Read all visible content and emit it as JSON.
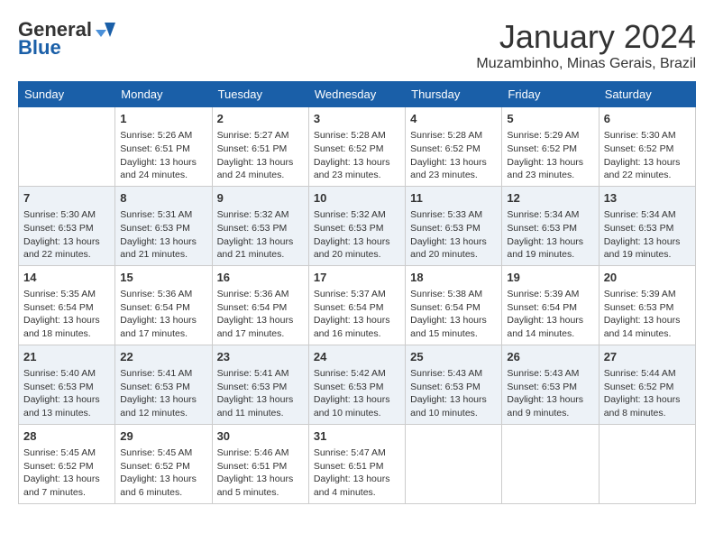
{
  "header": {
    "logo_general": "General",
    "logo_blue": "Blue",
    "month_title": "January 2024",
    "location": "Muzambinho, Minas Gerais, Brazil"
  },
  "weekdays": [
    "Sunday",
    "Monday",
    "Tuesday",
    "Wednesday",
    "Thursday",
    "Friday",
    "Saturday"
  ],
  "weeks": [
    [
      {
        "day": "",
        "info": ""
      },
      {
        "day": "1",
        "info": "Sunrise: 5:26 AM\nSunset: 6:51 PM\nDaylight: 13 hours\nand 24 minutes."
      },
      {
        "day": "2",
        "info": "Sunrise: 5:27 AM\nSunset: 6:51 PM\nDaylight: 13 hours\nand 24 minutes."
      },
      {
        "day": "3",
        "info": "Sunrise: 5:28 AM\nSunset: 6:52 PM\nDaylight: 13 hours\nand 23 minutes."
      },
      {
        "day": "4",
        "info": "Sunrise: 5:28 AM\nSunset: 6:52 PM\nDaylight: 13 hours\nand 23 minutes."
      },
      {
        "day": "5",
        "info": "Sunrise: 5:29 AM\nSunset: 6:52 PM\nDaylight: 13 hours\nand 23 minutes."
      },
      {
        "day": "6",
        "info": "Sunrise: 5:30 AM\nSunset: 6:52 PM\nDaylight: 13 hours\nand 22 minutes."
      }
    ],
    [
      {
        "day": "7",
        "info": "Sunrise: 5:30 AM\nSunset: 6:53 PM\nDaylight: 13 hours\nand 22 minutes."
      },
      {
        "day": "8",
        "info": "Sunrise: 5:31 AM\nSunset: 6:53 PM\nDaylight: 13 hours\nand 21 minutes."
      },
      {
        "day": "9",
        "info": "Sunrise: 5:32 AM\nSunset: 6:53 PM\nDaylight: 13 hours\nand 21 minutes."
      },
      {
        "day": "10",
        "info": "Sunrise: 5:32 AM\nSunset: 6:53 PM\nDaylight: 13 hours\nand 20 minutes."
      },
      {
        "day": "11",
        "info": "Sunrise: 5:33 AM\nSunset: 6:53 PM\nDaylight: 13 hours\nand 20 minutes."
      },
      {
        "day": "12",
        "info": "Sunrise: 5:34 AM\nSunset: 6:53 PM\nDaylight: 13 hours\nand 19 minutes."
      },
      {
        "day": "13",
        "info": "Sunrise: 5:34 AM\nSunset: 6:53 PM\nDaylight: 13 hours\nand 19 minutes."
      }
    ],
    [
      {
        "day": "14",
        "info": "Sunrise: 5:35 AM\nSunset: 6:54 PM\nDaylight: 13 hours\nand 18 minutes."
      },
      {
        "day": "15",
        "info": "Sunrise: 5:36 AM\nSunset: 6:54 PM\nDaylight: 13 hours\nand 17 minutes."
      },
      {
        "day": "16",
        "info": "Sunrise: 5:36 AM\nSunset: 6:54 PM\nDaylight: 13 hours\nand 17 minutes."
      },
      {
        "day": "17",
        "info": "Sunrise: 5:37 AM\nSunset: 6:54 PM\nDaylight: 13 hours\nand 16 minutes."
      },
      {
        "day": "18",
        "info": "Sunrise: 5:38 AM\nSunset: 6:54 PM\nDaylight: 13 hours\nand 15 minutes."
      },
      {
        "day": "19",
        "info": "Sunrise: 5:39 AM\nSunset: 6:54 PM\nDaylight: 13 hours\nand 14 minutes."
      },
      {
        "day": "20",
        "info": "Sunrise: 5:39 AM\nSunset: 6:53 PM\nDaylight: 13 hours\nand 14 minutes."
      }
    ],
    [
      {
        "day": "21",
        "info": "Sunrise: 5:40 AM\nSunset: 6:53 PM\nDaylight: 13 hours\nand 13 minutes."
      },
      {
        "day": "22",
        "info": "Sunrise: 5:41 AM\nSunset: 6:53 PM\nDaylight: 13 hours\nand 12 minutes."
      },
      {
        "day": "23",
        "info": "Sunrise: 5:41 AM\nSunset: 6:53 PM\nDaylight: 13 hours\nand 11 minutes."
      },
      {
        "day": "24",
        "info": "Sunrise: 5:42 AM\nSunset: 6:53 PM\nDaylight: 13 hours\nand 10 minutes."
      },
      {
        "day": "25",
        "info": "Sunrise: 5:43 AM\nSunset: 6:53 PM\nDaylight: 13 hours\nand 10 minutes."
      },
      {
        "day": "26",
        "info": "Sunrise: 5:43 AM\nSunset: 6:53 PM\nDaylight: 13 hours\nand 9 minutes."
      },
      {
        "day": "27",
        "info": "Sunrise: 5:44 AM\nSunset: 6:52 PM\nDaylight: 13 hours\nand 8 minutes."
      }
    ],
    [
      {
        "day": "28",
        "info": "Sunrise: 5:45 AM\nSunset: 6:52 PM\nDaylight: 13 hours\nand 7 minutes."
      },
      {
        "day": "29",
        "info": "Sunrise: 5:45 AM\nSunset: 6:52 PM\nDaylight: 13 hours\nand 6 minutes."
      },
      {
        "day": "30",
        "info": "Sunrise: 5:46 AM\nSunset: 6:51 PM\nDaylight: 13 hours\nand 5 minutes."
      },
      {
        "day": "31",
        "info": "Sunrise: 5:47 AM\nSunset: 6:51 PM\nDaylight: 13 hours\nand 4 minutes."
      },
      {
        "day": "",
        "info": ""
      },
      {
        "day": "",
        "info": ""
      },
      {
        "day": "",
        "info": ""
      }
    ]
  ]
}
